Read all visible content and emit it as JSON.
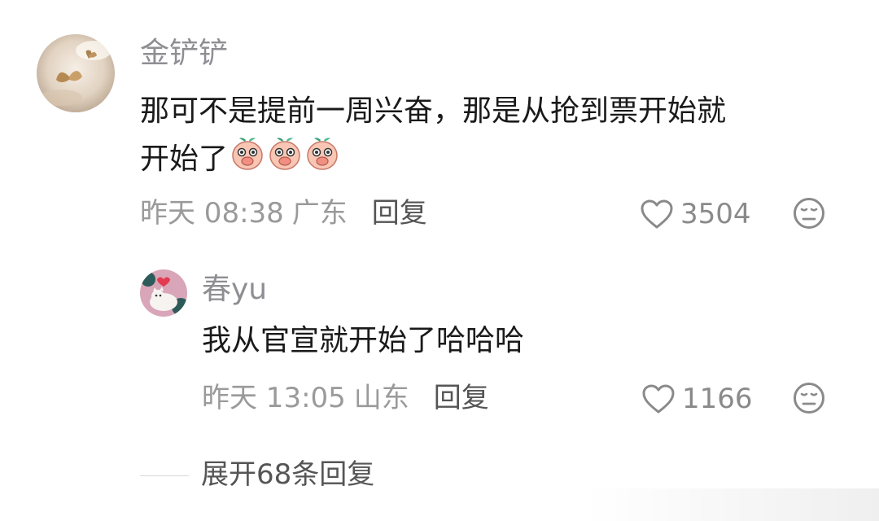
{
  "comments": [
    {
      "username": "金铲铲",
      "content_line1": "那可不是提前一周兴奋，那是从抢到票开始就",
      "content_line2": "开始了",
      "emoji_count": 3,
      "emoji_icon": "peach-face-covering-mouth-emoji",
      "time": "昨天 08:38",
      "location": "广东",
      "reply_label": "回复",
      "likes": "3504"
    },
    {
      "username": "春yu",
      "content": "我从官宣就开始了哈哈哈",
      "time": "昨天 13:05",
      "location": "山东",
      "reply_label": "回复",
      "likes": "1166"
    }
  ],
  "expand_label": "展开68条回复",
  "icons": {
    "like": "heart-outline-icon",
    "dislike": "unhappy-face-icon"
  },
  "colors": {
    "username": "#8e8e93",
    "content": "#1a1a1a",
    "meta": "#9a9a9a",
    "reply": "#555555"
  }
}
